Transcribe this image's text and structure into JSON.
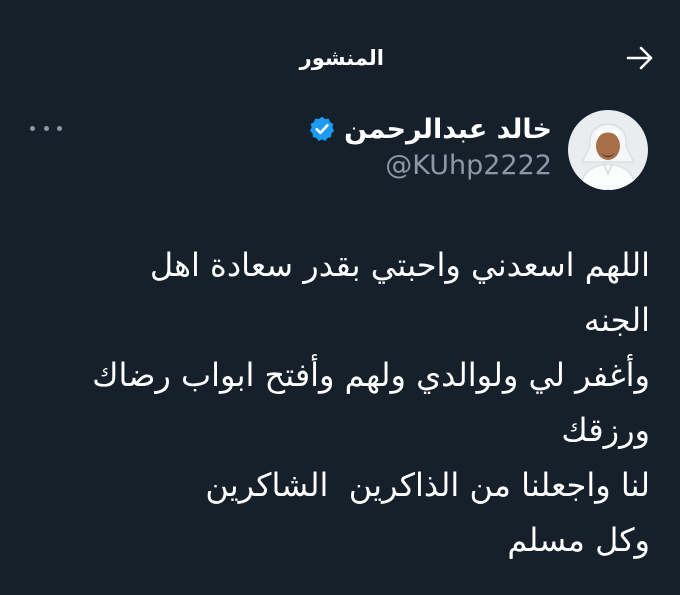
{
  "header": {
    "title": "المنشور",
    "back_icon": "arrow-right-icon"
  },
  "author": {
    "name": "خالد عبدالرحمن",
    "handle": "@KUhp2222",
    "verified": true,
    "verified_color": "#1d9bf0",
    "avatar_icon": "user-avatar"
  },
  "more_icon": "more-horizontal-icon",
  "tweet": {
    "lines": [
      "اللهم اسعدني واحبتي بقدر سعادة اهل",
      "الجنه",
      "وأغفر لي ولوالدي ولهم وأفتح ابواب رضاك",
      "ورزقك",
      "لنا واجعلنا من الذاكرين  الشاكرين",
      "وكل مسلم"
    ]
  },
  "colors": {
    "background": "#15202b",
    "text_primary": "#ffffff",
    "text_secondary": "#8b98a5"
  }
}
